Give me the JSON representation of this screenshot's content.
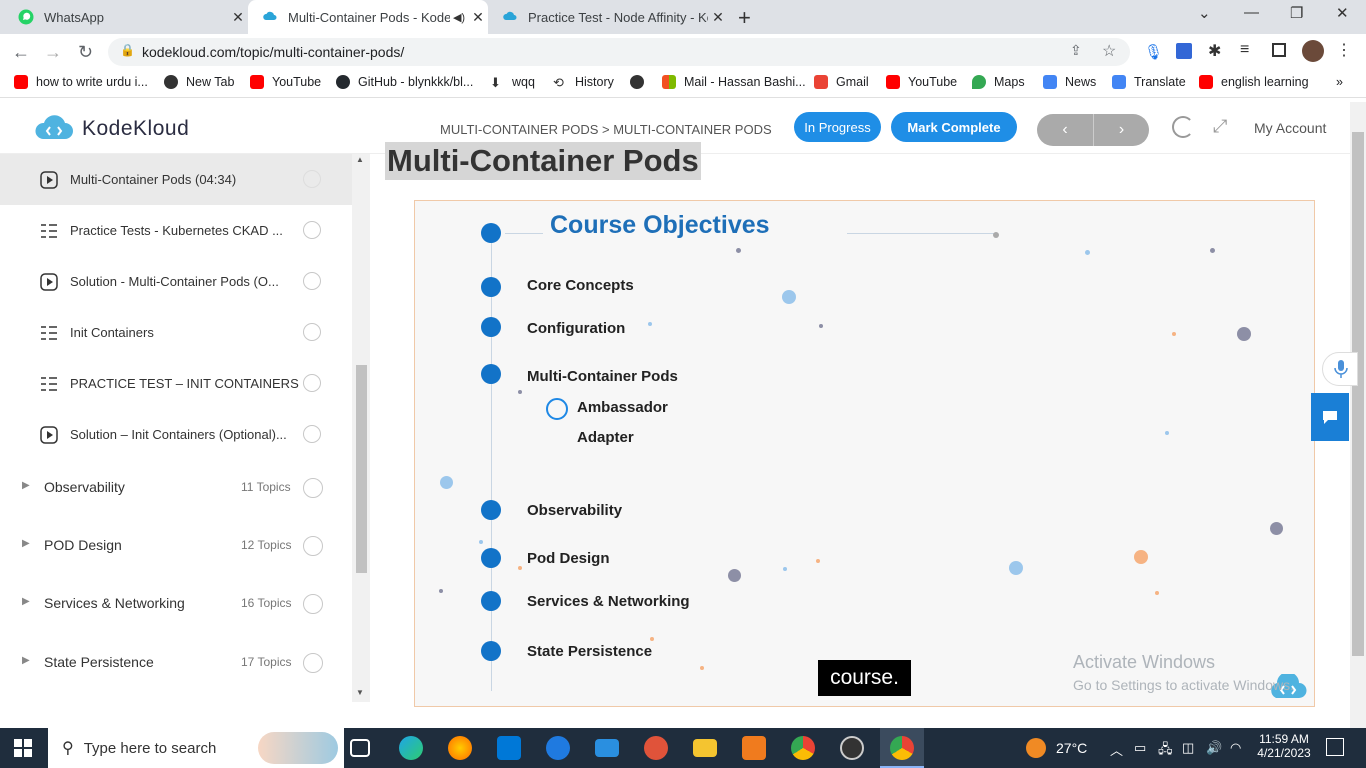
{
  "browser": {
    "tabs": [
      {
        "title": "WhatsApp",
        "active": false
      },
      {
        "title": "Multi-Container Pods - Kode",
        "active": true
      },
      {
        "title": "Practice Test - Node Affinity - Ko",
        "active": false
      }
    ],
    "url": "kodekloud.com/topic/multi-container-pods/",
    "bookmarks": [
      "how to write urdu i...",
      "New Tab",
      "YouTube",
      "GitHub - blynkkk/bl...",
      "wqq",
      "History",
      "",
      "Mail - Hassan Bashi...",
      "Gmail",
      "YouTube",
      "Maps",
      "News",
      "Translate",
      "english learning"
    ],
    "colors": {
      "accent": "#1f8ee6",
      "tabbar": "#dee1e6"
    }
  },
  "header": {
    "logo": "KodeKloud",
    "breadcrumb": "MULTI-CONTAINER PODS > MULTI-CONTAINER PODS",
    "status": "In Progress",
    "mark_complete": "Mark Complete",
    "prev": "‹",
    "next": "›",
    "account": "My Account"
  },
  "sidebar": {
    "lessons": [
      {
        "label": "Multi-Container Pods (04:34)",
        "icon": "play-icon",
        "active": true
      },
      {
        "label": "Practice Tests - Kubernetes CKAD ...",
        "icon": "list-icon",
        "active": false
      },
      {
        "label": "Solution - Multi-Container Pods (O...",
        "icon": "play-icon",
        "active": false
      },
      {
        "label": "Init Containers",
        "icon": "list-icon",
        "active": false
      },
      {
        "label": "PRACTICE TEST – INIT CONTAINERS",
        "icon": "list-icon",
        "active": false
      },
      {
        "label": "Solution – Init Containers (Optional)...",
        "icon": "play-icon",
        "active": false
      }
    ],
    "modules": [
      {
        "label": "Observability",
        "count": "11 Topics"
      },
      {
        "label": "POD Design",
        "count": "12 Topics"
      },
      {
        "label": "Services & Networking",
        "count": "16 Topics"
      },
      {
        "label": "State Persistence",
        "count": "17 Topics"
      }
    ]
  },
  "main": {
    "title": "Multi-Container Pods",
    "slide": {
      "heading": "Course Objectives",
      "items": [
        "Core Concepts",
        "Configuration",
        "Multi-Container Pods",
        "Observability",
        "Pod Design",
        "Services & Networking",
        "State Persistence"
      ],
      "subitems": [
        "Ambassador",
        "Adapter"
      ]
    },
    "caption": "course.",
    "watermark_title": "Activate Windows",
    "watermark_sub": "Go to Settings to activate Windows."
  },
  "taskbar": {
    "search_placeholder": "Type here to search",
    "weather": "27°C",
    "time": "11:59 AM",
    "date": "4/21/2023"
  }
}
